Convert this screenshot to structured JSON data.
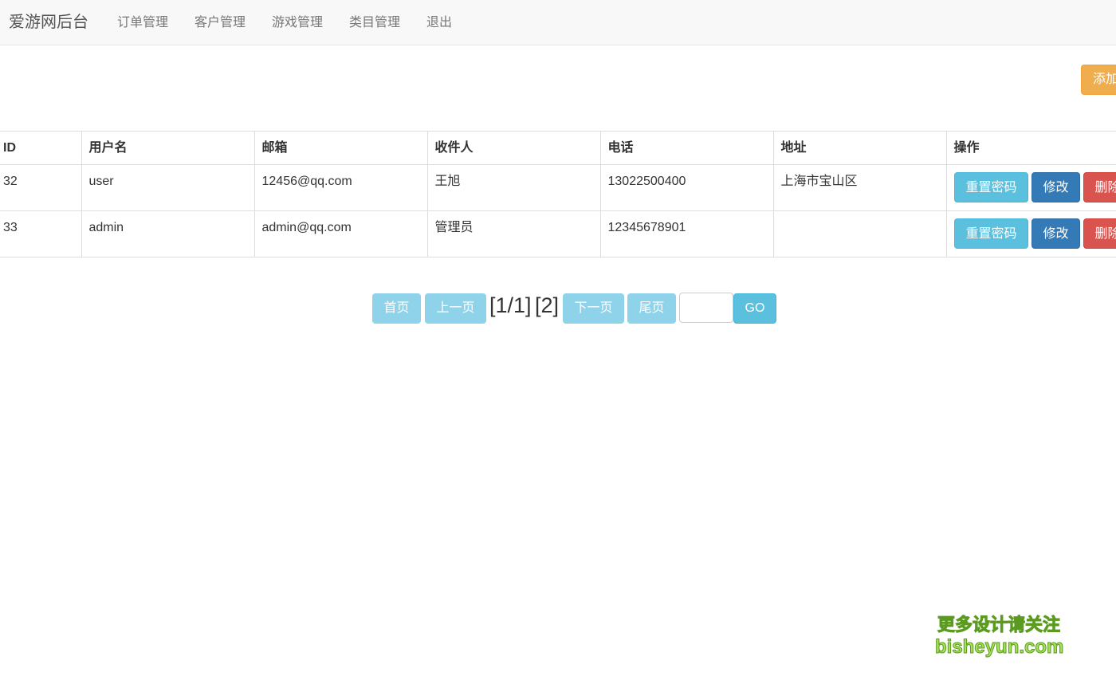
{
  "navbar": {
    "brand": "爱游网后台",
    "links": [
      "订单管理",
      "客户管理",
      "游戏管理",
      "类目管理",
      "退出"
    ]
  },
  "toolbar": {
    "add_label": "添加"
  },
  "table": {
    "headers": [
      "ID",
      "用户名",
      "邮箱",
      "收件人",
      "电话",
      "地址",
      "操作"
    ],
    "rows": [
      {
        "id": "32",
        "username": "user",
        "email": "12456@qq.com",
        "recipient": "王旭",
        "phone": "13022500400",
        "address": "上海市宝山区"
      },
      {
        "id": "33",
        "username": "admin",
        "email": "admin@qq.com",
        "recipient": "管理员",
        "phone": "12345678901",
        "address": ""
      }
    ],
    "actions": {
      "reset": "重置密码",
      "edit": "修改",
      "delete": "删除"
    }
  },
  "pager": {
    "first": "首页",
    "prev": "上一页",
    "current": "[1/1]",
    "page_link": "[2]",
    "next": "下一页",
    "last": "尾页",
    "input_value": "",
    "go": "GO"
  },
  "watermark": {
    "line1": "更多设计请关注",
    "line2": "bisheyun.com"
  }
}
